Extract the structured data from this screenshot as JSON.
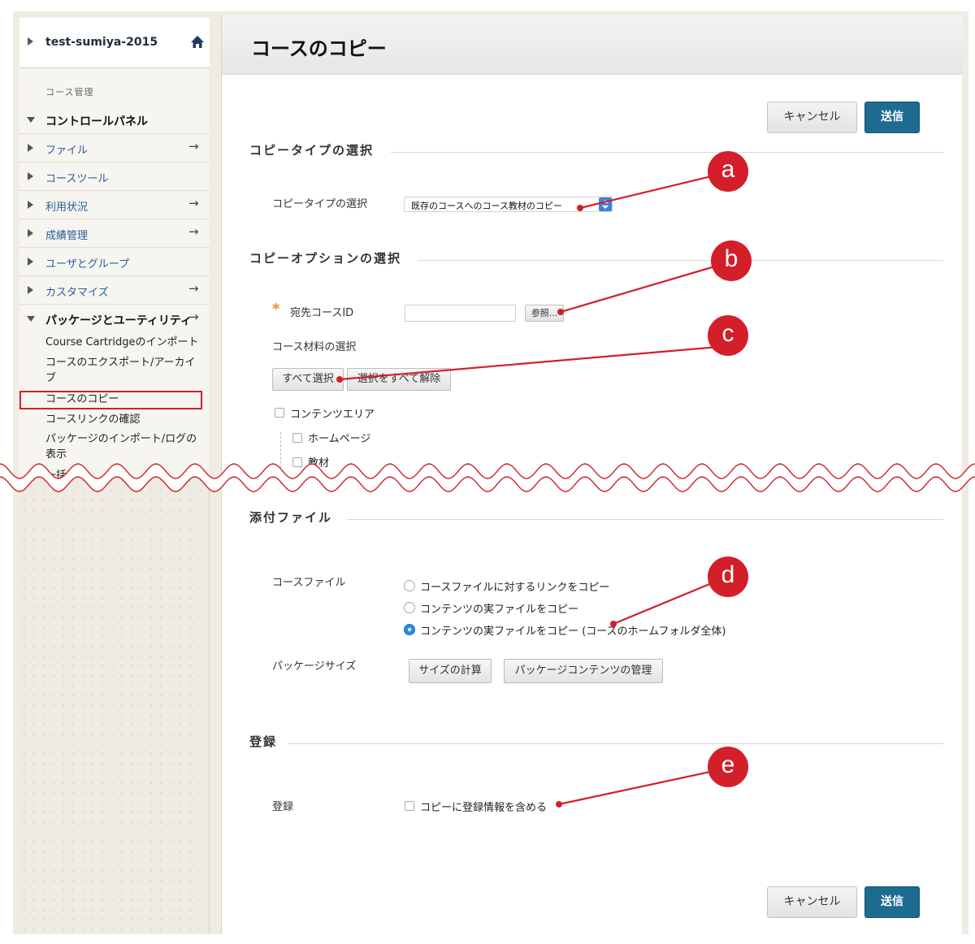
{
  "sidebar": {
    "course_name": "test-sumiya-2015",
    "section_label": "コース管理",
    "control_panel": "コントロールパネル",
    "items": [
      {
        "label": "ファイル",
        "arrow": "→"
      },
      {
        "label": "コースツール",
        "arrow": ""
      },
      {
        "label": "利用状況",
        "arrow": "→"
      },
      {
        "label": "成績管理",
        "arrow": "→"
      },
      {
        "label": "ユーザとグループ",
        "arrow": ""
      },
      {
        "label": "カスタマイズ",
        "arrow": "→"
      }
    ],
    "packages_head": "パッケージとユーティリティ",
    "packages_arrow": "→",
    "sub_items": [
      "Course Cartridgeのインポート",
      "コースのエクスポート/アーカイブ",
      "コースのコピー",
      "コースリンクの確認",
      "パッケージのインポート/ログの表示",
      "一括"
    ]
  },
  "main": {
    "title": "コースのコピー",
    "cancel_label": "キャンセル",
    "submit_label": "送信",
    "copy_type": {
      "section_title": "コピータイプの選択",
      "label": "コピータイプの選択",
      "selected": "既存のコースへのコース教材のコピー"
    },
    "copy_options": {
      "section_title": "コピーオプションの選択",
      "required_mark": "*",
      "dest_label": "宛先コースID",
      "dest_value": "",
      "browse_label": "参照...",
      "materials_label": "コース材料の選択",
      "select_all": "すべて選択",
      "deselect_all": "選択をすべて解除",
      "tree": [
        "コンテンツエリア",
        "ホームページ",
        "教材"
      ]
    },
    "attachments": {
      "section_title": "添付ファイル",
      "course_files_label": "コースファイル",
      "options": [
        {
          "label": "コースファイルに対するリンクをコピー",
          "checked": false
        },
        {
          "label": "コンテンツの実ファイルをコピー",
          "checked": false
        },
        {
          "label": "コンテンツの実ファイルをコピー (コースのホームフォルダ全体)",
          "checked": true
        }
      ],
      "package_size_label": "パッケージサイズ",
      "calc_size": "サイズの計算",
      "manage_package": "パッケージコンテンツの管理"
    },
    "enrollment": {
      "section_title": "登録",
      "label": "登録",
      "option": "コピーに登録情報を含める"
    }
  },
  "callouts": [
    "a",
    "b",
    "c",
    "d",
    "e"
  ],
  "colors": {
    "accent_red": "#d21f2a",
    "submit_blue": "#1e6b92",
    "link_blue": "#2b5c9a",
    "required_orange": "#f08c1e"
  }
}
